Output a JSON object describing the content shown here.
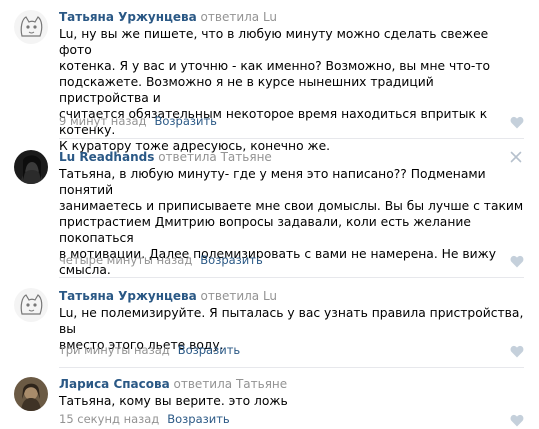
{
  "comments": [
    {
      "author": "Татьяна Уржунцева",
      "action": "ответила Lu",
      "lines": [
        "Lu, ну вы же пишете, что в любую минуту можно сделать свежее фото",
        "котенка. Я у вас и уточню - как именно? Возможно, вы мне что-то",
        "подскажете. Возможно я не в курсе нынешних традиций пристройства и",
        "считается обязательным некоторое время находиться впритык к котенку.",
        "К куратору тоже адресуюсь, конечно же."
      ],
      "time": "9 минут назад",
      "reply": "Возразить"
    },
    {
      "author": "Lu Readhands",
      "action": "ответила Татьяне",
      "lines": [
        "Татьяна, в любую минуту- где у меня это написано?? Подменами понятий",
        "занимаетесь и приписываете мне свои домыслы. Вы бы лучше с таким",
        "пристрастием Дмитрию вопросы задавали, коли есть желание покопаться",
        "в мотивации. Далее полемизировать с вами не намерена. Не вижу",
        "смысла."
      ],
      "time": "четыре минуты назад",
      "reply": "Возразить"
    },
    {
      "author": "Татьяна Уржунцева",
      "action": "ответила Lu",
      "lines": [
        "Lu, не полемизируйте. Я пыталась у вас узнать правила пристройства, вы",
        "вместо этого льете воду."
      ],
      "time": "три минуты назад",
      "reply": "Возразить"
    },
    {
      "author": "Лариса Спасова",
      "action": "ответила Татьяне",
      "lines": [
        "Татьяна, кому вы верите. это ложь"
      ],
      "time": "15 секунд назад",
      "reply": "Возразить"
    }
  ],
  "colors": {
    "link": "#2a5885",
    "muted": "#939393",
    "separator": "#e7e8ec",
    "heart": "#c5d0db"
  },
  "icons": {
    "like": "heart-icon",
    "delete": "close-icon"
  }
}
